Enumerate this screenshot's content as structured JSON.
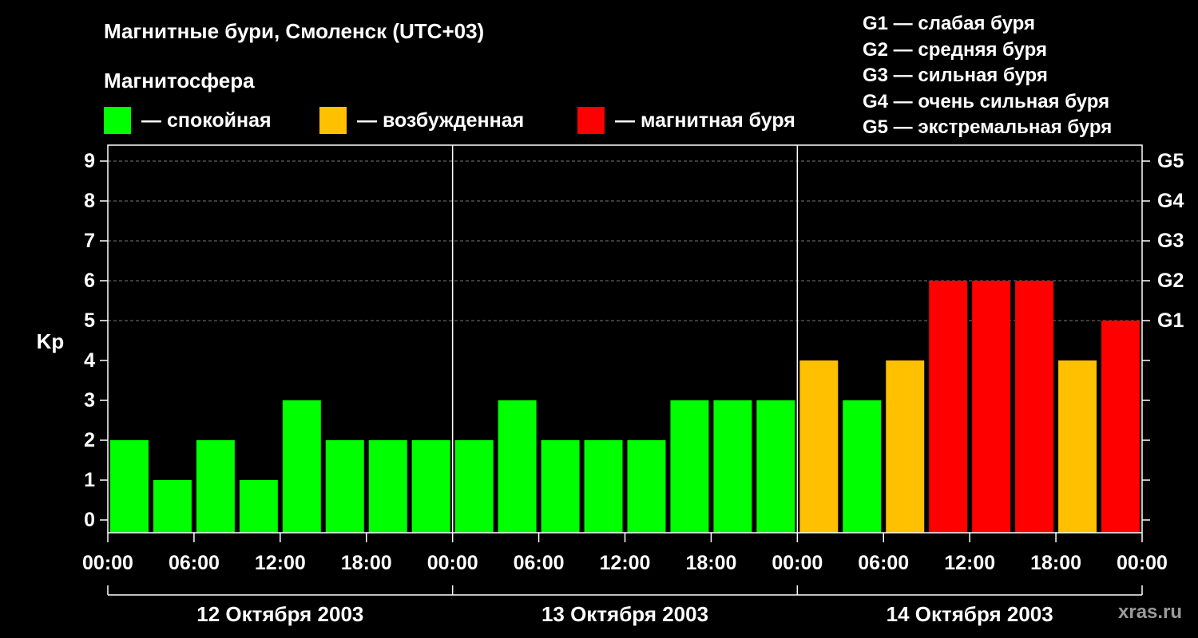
{
  "title": "Магнитные бури, Смоленск (UTC+03)",
  "magnetosphere_label": "Магнитосфера",
  "legend": [
    {
      "label": "— спокойная",
      "color": "#00ff00"
    },
    {
      "label": "— возбужденная",
      "color": "#ffc000"
    },
    {
      "label": "— магнитная буря",
      "color": "#ff0000"
    }
  ],
  "g_scale": [
    "G1 — слабая буря",
    "G2 — средняя буря",
    "G3 — сильная буря",
    "G4 — очень сильная буря",
    "G5 — экстремальная буря"
  ],
  "site": "xras.ru",
  "chart_data": {
    "type": "bar",
    "ylabel": "Kp",
    "ylim": [
      0,
      9
    ],
    "yticks": [
      0,
      1,
      2,
      3,
      4,
      5,
      6,
      7,
      8,
      9
    ],
    "right_ticks": [
      {
        "value": 5,
        "label": "G1"
      },
      {
        "value": 6,
        "label": "G2"
      },
      {
        "value": 7,
        "label": "G3"
      },
      {
        "value": 8,
        "label": "G4"
      },
      {
        "value": 9,
        "label": "G5"
      }
    ],
    "x_tick_labels": [
      "00:00",
      "06:00",
      "12:00",
      "18:00",
      "00:00",
      "06:00",
      "12:00",
      "18:00",
      "00:00",
      "06:00",
      "12:00",
      "18:00",
      "00:00"
    ],
    "days": [
      "12 Октября 2003",
      "13 Октября 2003",
      "14 Октября 2003"
    ],
    "grid": "dashed horizontal at 5–9",
    "bars_per_day": 8,
    "values": [
      2,
      1,
      2,
      1,
      3,
      2,
      2,
      2,
      2,
      3,
      2,
      2,
      2,
      3,
      3,
      3,
      4,
      3,
      4,
      6,
      6,
      6,
      4,
      5
    ],
    "colors": {
      "quiet": "#00ff00",
      "active": "#ffc000",
      "storm": "#ff0000"
    }
  }
}
